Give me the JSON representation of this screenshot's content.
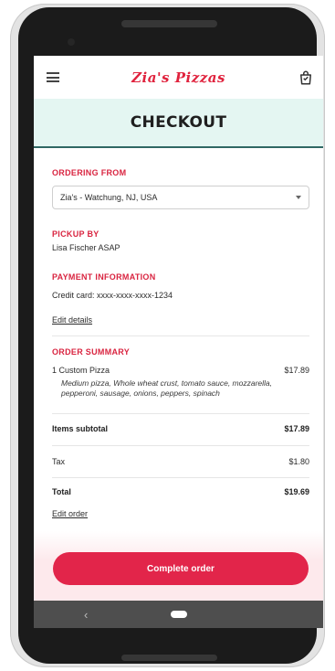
{
  "app": {
    "brand": "Zia's Pizzas",
    "page_title": "CHECKOUT"
  },
  "ordering_from": {
    "label": "ORDERING FROM",
    "selected": "Zia's - Watchung, NJ, USA"
  },
  "pickup": {
    "label": "PICKUP BY",
    "value": "Lisa Fischer ASAP"
  },
  "payment": {
    "label": "PAYMENT INFORMATION",
    "value": "Credit card: xxxx-xxxx-xxxx-1234",
    "edit_link": "Edit details"
  },
  "summary": {
    "label": "ORDER SUMMARY",
    "item": {
      "name": "1 Custom Pizza",
      "price": "$17.89",
      "description": "Medium pizza, Whole wheat crust, tomato sauce, mozzarella, pepperoni, sausage, onions, peppers, spinach"
    },
    "subtotal_label": "Items subtotal",
    "subtotal": "$17.89",
    "tax_label": "Tax",
    "tax": "$1.80",
    "total_label": "Total",
    "total": "$19.69",
    "edit_link": "Edit order"
  },
  "cta": {
    "label": "Complete order"
  },
  "system_nav": {
    "back_glyph": "‹"
  },
  "colors": {
    "brand_red": "#e0223d",
    "button_red": "#e2254a",
    "header_band": "#e4f6f2",
    "header_border": "#2f6864"
  },
  "icons": [
    "menu-icon",
    "shopping-bag-icon",
    "chevron-down-icon",
    "back-icon",
    "home-icon"
  ]
}
